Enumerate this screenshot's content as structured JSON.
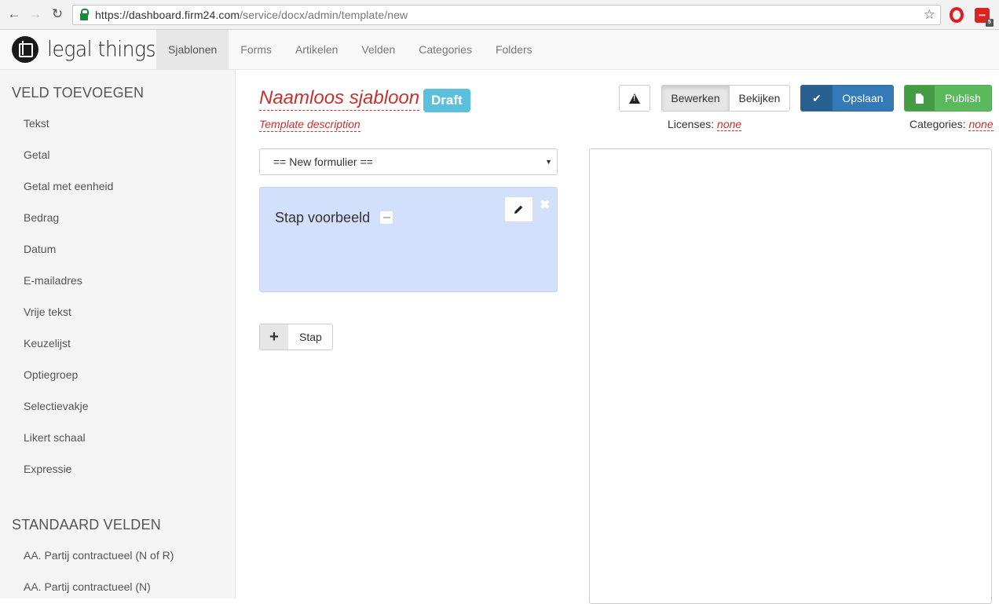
{
  "browser": {
    "url_host": "https://dashboard.firm24.com",
    "url_path": "/service/docx/admin/template/new",
    "ext_badge": "5"
  },
  "navbar": {
    "logo_text": "legal things",
    "tabs": [
      "Sjablonen",
      "Forms",
      "Artikelen",
      "Velden",
      "Categories",
      "Folders"
    ],
    "active_tab": "Sjablonen"
  },
  "sidebar": {
    "section1_heading": "VELD TOEVOEGEN",
    "items": [
      "Tekst",
      "Getal",
      "Getal met eenheid",
      "Bedrag",
      "Datum",
      "E-mailadres",
      "Vrije tekst",
      "Keuzelijst",
      "Optiegroep",
      "Selectievakje",
      "Likert schaal",
      "Expressie"
    ],
    "section2_heading": "STANDAARD VELDEN",
    "standard_items": [
      "AA. Partij contractueel (N of R)",
      "AA. Partij contractueel (N)"
    ]
  },
  "template": {
    "title": "Naamloos sjabloon",
    "status": "Draft",
    "description": "Template description"
  },
  "toolbar": {
    "edit_label": "Bewerken",
    "view_label": "Bekijken",
    "save_label": "Opslaan",
    "publish_label": "Publish"
  },
  "meta": {
    "licenses_label": "Licenses:",
    "licenses_value": "none",
    "categories_label": "Categories:",
    "categories_value": "none"
  },
  "form": {
    "selected": "== New formulier ==",
    "step_title": "Stap voorbeeld",
    "add_step_label": "Stap"
  },
  "colors": {
    "accent_red": "#c9302c",
    "draft_badge": "#5bc0de",
    "save_blue": "#337ab7",
    "publish_green": "#5cb85c",
    "step_card_bg": "#d2e0fb"
  }
}
